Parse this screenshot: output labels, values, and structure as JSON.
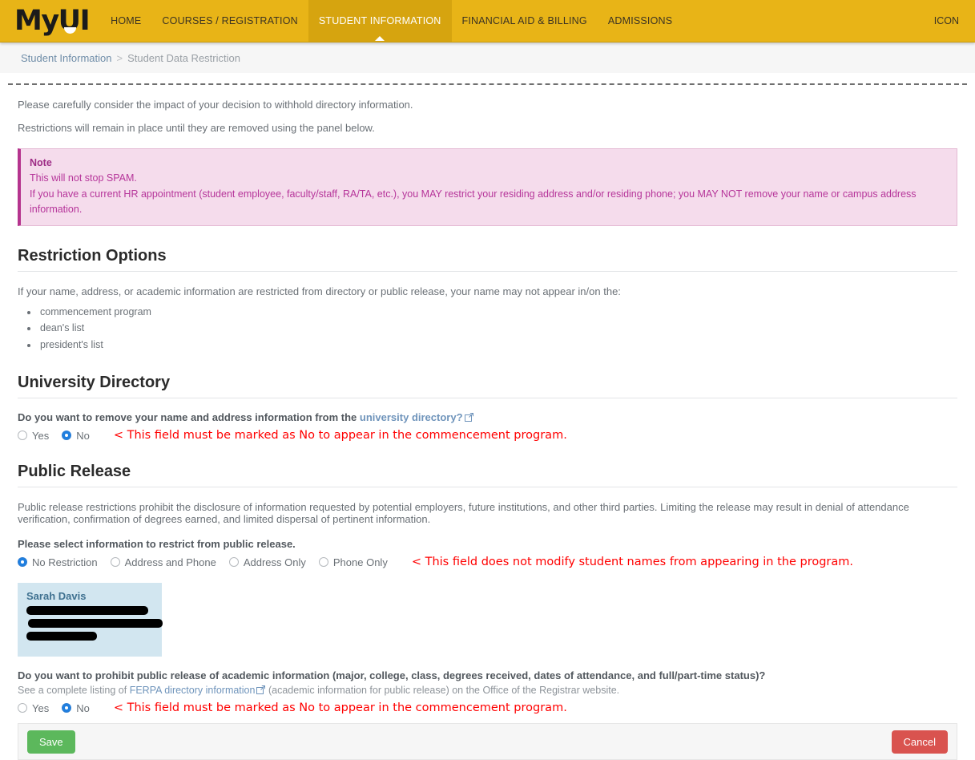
{
  "nav": {
    "brand_my": "My",
    "brand_ui": "UI",
    "items": [
      {
        "label": "HOME",
        "active": false
      },
      {
        "label": "COURSES / REGISTRATION",
        "active": false
      },
      {
        "label": "STUDENT INFORMATION",
        "active": true
      },
      {
        "label": "FINANCIAL AID & BILLING",
        "active": false
      },
      {
        "label": "ADMISSIONS",
        "active": false
      }
    ],
    "right_icon_label": "ICON",
    "accent_color": "#e8b417",
    "active_color": "#d6a40f"
  },
  "breadcrumb": {
    "parent": "Student Information",
    "separator": ">",
    "current": "Student Data Restriction"
  },
  "intro": {
    "line1": "Please carefully consider the impact of your decision to withhold directory information.",
    "line2": "Restrictions will remain in place until they are removed using the panel below."
  },
  "note": {
    "title": "Note",
    "line1": "This will not stop SPAM.",
    "line2": "If you have a current HR appointment (student employee, faculty/staff, RA/TA, etc.), you MAY restrict your residing address and/or residing phone; you MAY NOT remove your name or campus address information.",
    "color": "#b6359a",
    "background": "#f5dcec"
  },
  "restriction_options": {
    "heading": "Restriction Options",
    "intro": "If your name, address, or academic information are restricted from directory or public release, your name may not appear in/on the:",
    "bullets": [
      "commencement program",
      "dean's list",
      "president's list"
    ]
  },
  "university_directory": {
    "heading": "University Directory",
    "question_prefix": "Do you want to remove your name and address information from the",
    "link_text": "university directory?",
    "link_icon": "external-link-icon",
    "options": [
      {
        "label": "Yes",
        "selected": false
      },
      {
        "label": "No",
        "selected": true
      }
    ],
    "annotation": "< This field must be marked as No to appear in the commencement program."
  },
  "public_release": {
    "heading": "Public Release",
    "description": "Public release restrictions prohibit the disclosure of information requested by potential employers, future institutions, and other third parties. Limiting the release may result in denial of attendance verification, confirmation of degrees earned, and limited dispersal of pertinent information.",
    "select_label": "Please select information to restrict from public release.",
    "options": [
      {
        "label": "No Restriction",
        "selected": true
      },
      {
        "label": "Address and Phone",
        "selected": false
      },
      {
        "label": "Address Only",
        "selected": false
      },
      {
        "label": "Phone Only",
        "selected": false
      }
    ],
    "annotation": "< This field does not modify student names from appearing in the program."
  },
  "address_card": {
    "name": "Sarah Davis",
    "redacted_lines": 3,
    "background": "#d2e6f0"
  },
  "academic_release": {
    "question": "Do you want to prohibit public release of academic information (major, college, class, degrees received, dates of attendance, and full/part-time status)?",
    "help_prefix": "See a complete listing of",
    "help_link": "FERPA directory information",
    "help_suffix": "(academic information for public release) on the Office of the Registrar website.",
    "options": [
      {
        "label": "Yes",
        "selected": false
      },
      {
        "label": "No",
        "selected": true
      }
    ],
    "annotation": "< This field must be marked as No to appear in the commencement program."
  },
  "actions": {
    "save_label": "Save",
    "cancel_label": "Cancel",
    "save_color": "#5cb85c",
    "cancel_color": "#d9534f"
  }
}
